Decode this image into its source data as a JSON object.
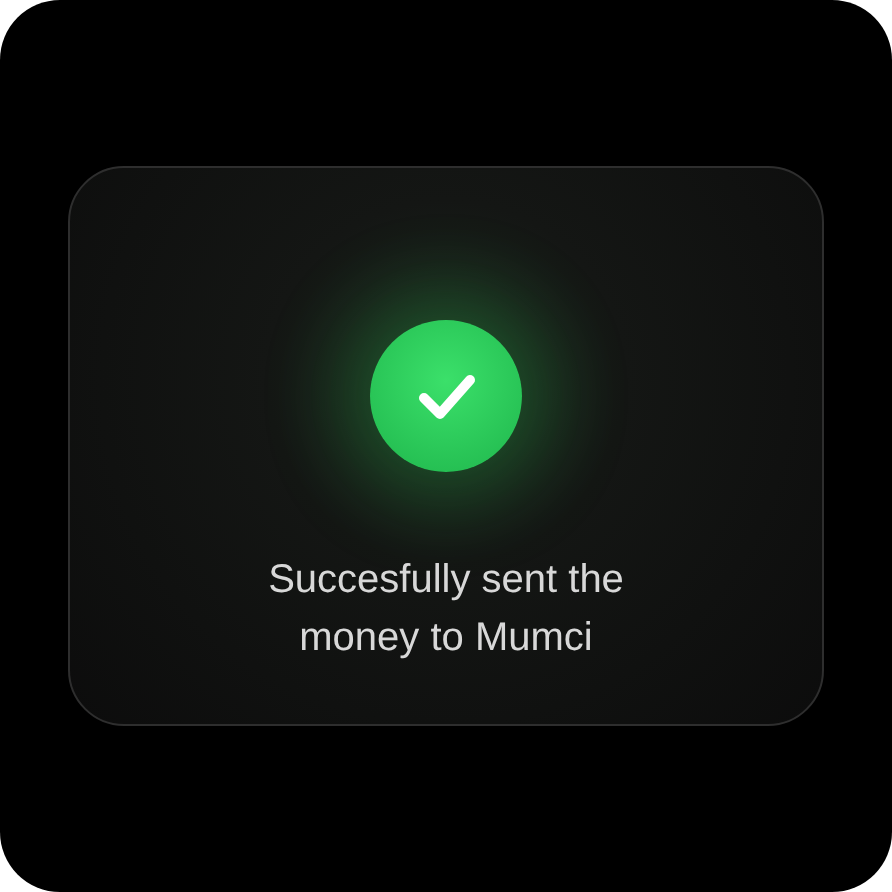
{
  "dialog": {
    "success": true,
    "message": "Succesfully sent the money to Mumci"
  }
}
